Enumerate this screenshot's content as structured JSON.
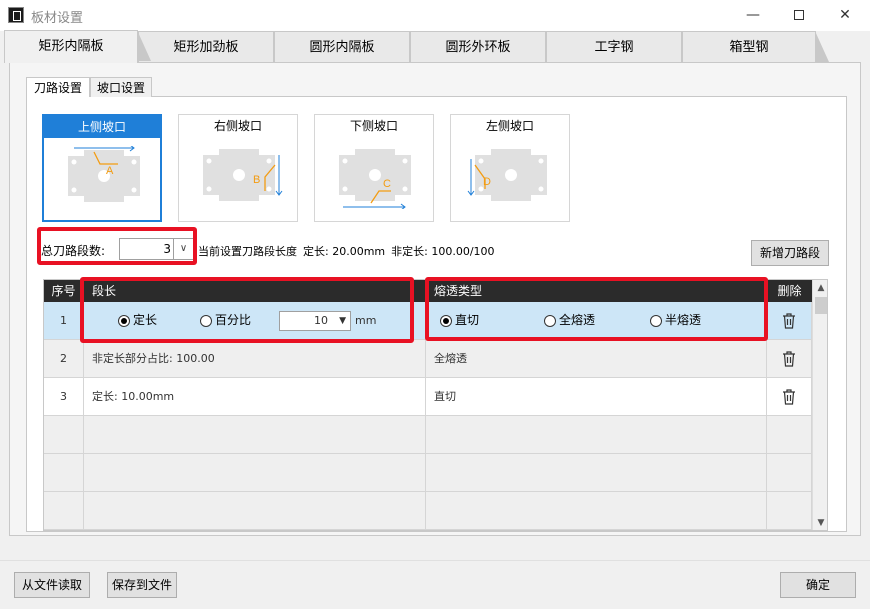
{
  "window": {
    "title": "板材设置",
    "minimize": "—",
    "close": "✕"
  },
  "outer_tabs": [
    "矩形内隔板",
    "矩形加劲板",
    "圆形内隔板",
    "圆形外环板",
    "工字钢",
    "箱型钢"
  ],
  "inner_tabs": [
    "刀路设置",
    "坡口设置"
  ],
  "bevel_cards": [
    {
      "label": "上侧坡口",
      "letter": "A"
    },
    {
      "label": "右侧坡口",
      "letter": "B"
    },
    {
      "label": "下侧坡口",
      "letter": "C"
    },
    {
      "label": "左侧坡口",
      "letter": "D"
    }
  ],
  "segments": {
    "label": "总刀路段数:",
    "value": "3",
    "info_prefix": "当前设置刀路段长度",
    "fixed": "定长: 20.00mm",
    "variable": "非定长: 100.00/100",
    "add_button": "新增刀路段"
  },
  "grid": {
    "headers": {
      "index": "序号",
      "length": "段长",
      "type": "熔透类型",
      "delete": "删除"
    },
    "rows": [
      {
        "index": "1",
        "length_text": "",
        "type_text": ""
      },
      {
        "index": "2",
        "length_text": "非定长部分占比: 100.00",
        "type_text": "全熔透"
      },
      {
        "index": "3",
        "length_text": "定长: 10.00mm",
        "type_text": "直切"
      }
    ],
    "edit_row": {
      "len_opt1": "定长",
      "len_opt2": "百分比",
      "len_value": "10",
      "len_unit": "mm",
      "type_opt1": "直切",
      "type_opt2": "全熔透",
      "type_opt3": "半熔透"
    }
  },
  "buttons": {
    "read": "从文件读取",
    "save": "保存到文件",
    "ok": "确定"
  },
  "colors": {
    "accent": "#1f7fd8",
    "highlight": "#e81123",
    "bevel": "#f39c12",
    "selected_row": "#cde6f7"
  },
  "icons": {
    "delete": "trash-icon",
    "dropdown": "chevron-down-icon"
  }
}
